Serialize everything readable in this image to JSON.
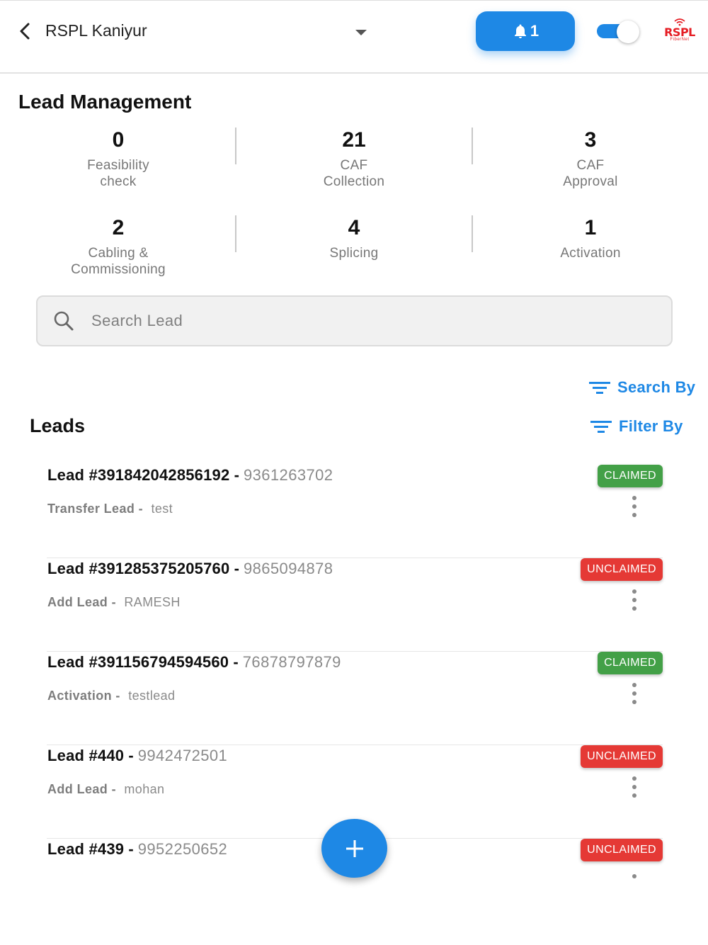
{
  "header": {
    "branch": "RSPL Kaniyur",
    "notification_count": "1",
    "logo_text": "RSPL",
    "logo_sub": "FiberNet"
  },
  "page_title": "Lead Management",
  "stats": [
    {
      "count": "0",
      "label_line1": "Feasibility",
      "label_line2": "check"
    },
    {
      "count": "21",
      "label_line1": "CAF",
      "label_line2": "Collection"
    },
    {
      "count": "3",
      "label_line1": "CAF",
      "label_line2": "Approval"
    },
    {
      "count": "2",
      "label_line1": "Cabling &",
      "label_line2": "Commissioning"
    },
    {
      "count": "4",
      "label_line1": "Splicing",
      "label_line2": ""
    },
    {
      "count": "1",
      "label_line1": "Activation",
      "label_line2": ""
    }
  ],
  "search": {
    "placeholder": "Search Lead"
  },
  "search_by_label": "Search By",
  "filter_by_label": "Filter By",
  "leads_title": "Leads",
  "leads": [
    {
      "id": "Lead #391842042856192",
      "phone": "9361263702",
      "stage": "Transfer Lead",
      "assignee": "test",
      "status": "CLAIMED"
    },
    {
      "id": "Lead #391285375205760",
      "phone": "9865094878",
      "stage": "Add Lead",
      "assignee": "RAMESH",
      "status": "UNCLAIMED"
    },
    {
      "id": "Lead #391156794594560",
      "phone": "76878797879",
      "stage": "Activation",
      "assignee": "testlead",
      "status": "CLAIMED"
    },
    {
      "id": "Lead #440",
      "phone": "9942472501",
      "stage": "Add Lead",
      "assignee": "mohan",
      "status": "UNCLAIMED"
    },
    {
      "id": "Lead #439",
      "phone": "9952250652",
      "stage": "",
      "assignee": "",
      "status": "UNCLAIMED"
    }
  ],
  "colors": {
    "primary": "#1e88e5",
    "claimed": "#43a047",
    "unclaimed": "#e53935",
    "logo_red": "#e51c23"
  }
}
